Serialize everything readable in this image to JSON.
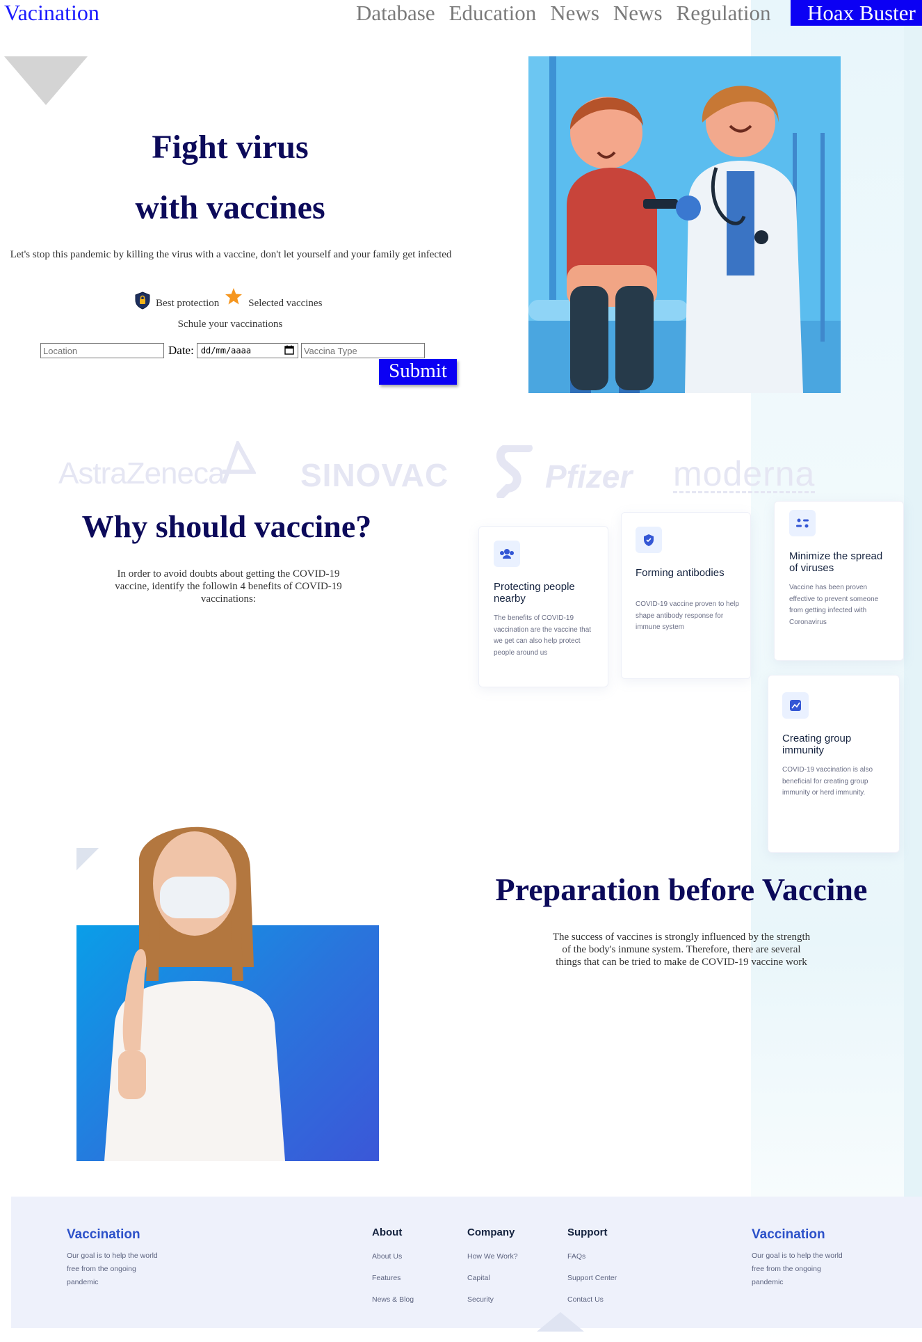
{
  "nav": {
    "brand": "Vacination",
    "links": [
      "Database",
      "Education",
      "News",
      "News",
      "Regulation"
    ],
    "cta": "Hoax Buster"
  },
  "hero": {
    "title_line1": "Fight virus",
    "title_line2": "with vaccines",
    "description": "Let's stop this pandemic by killing the virus with a vaccine, don't let yourself and your family get infected",
    "feature1": "Best protection",
    "feature2": "Selected vaccines",
    "schedule_label": "Schule your vaccinations",
    "form": {
      "location_placeholder": "Location",
      "date_label": "Date:",
      "date_placeholder": "dd/mm/aaaa",
      "vaccine_placeholder": "Vaccina Type",
      "submit": "Submit"
    }
  },
  "brands": [
    "AstraZeneca",
    "SINOVAC",
    "Pfizer",
    "moderna"
  ],
  "why": {
    "title": "Why should vaccine?",
    "description": "In order to avoid doubts about getting the COVID-19 vaccine, identify the followin 4 benefits of COVID-19 vaccinations:",
    "cards": [
      {
        "icon": "people-icon",
        "title": "Protecting people nearby",
        "text": "The benefits of COVID-19 vaccination are the vaccine that we get can also help protect people around us"
      },
      {
        "icon": "shield-icon",
        "title": "Forming antibodies",
        "text": "COVID-19 vaccine proven to help shape antibody response for immune system"
      },
      {
        "icon": "virus-icon",
        "title": "Minimize the spread of viruses",
        "text": "Vaccine has been proven effective to prevent someone from getting infected with Coronavirus"
      },
      {
        "icon": "chart-icon",
        "title": "Creating group immunity",
        "text": "COVID-19 vaccination is also beneficial for creating group immunity or herd immunity."
      }
    ]
  },
  "prep": {
    "title": "Preparation before Vaccine",
    "description": "The success of vaccines is strongly influenced by the strength of the body's inmune system. Therefore, there are several things that can be tried to make de COVID-19 vaccine work"
  },
  "footer": {
    "brand": "Vaccination",
    "tagline": "Our goal is to help the world free from the ongoing pandemic",
    "columns": [
      {
        "heading": "About",
        "links": [
          "About Us",
          "Features",
          "News & Blog"
        ]
      },
      {
        "heading": "Company",
        "links": [
          "How We Work?",
          "Capital",
          "Security"
        ]
      },
      {
        "heading": "Support",
        "links": [
          "FAQs",
          "Support Center",
          "Contact Us"
        ]
      }
    ],
    "brand2": "Vaccination",
    "tagline2": "Our goal is to help the world free from the ongoing pandemic"
  }
}
